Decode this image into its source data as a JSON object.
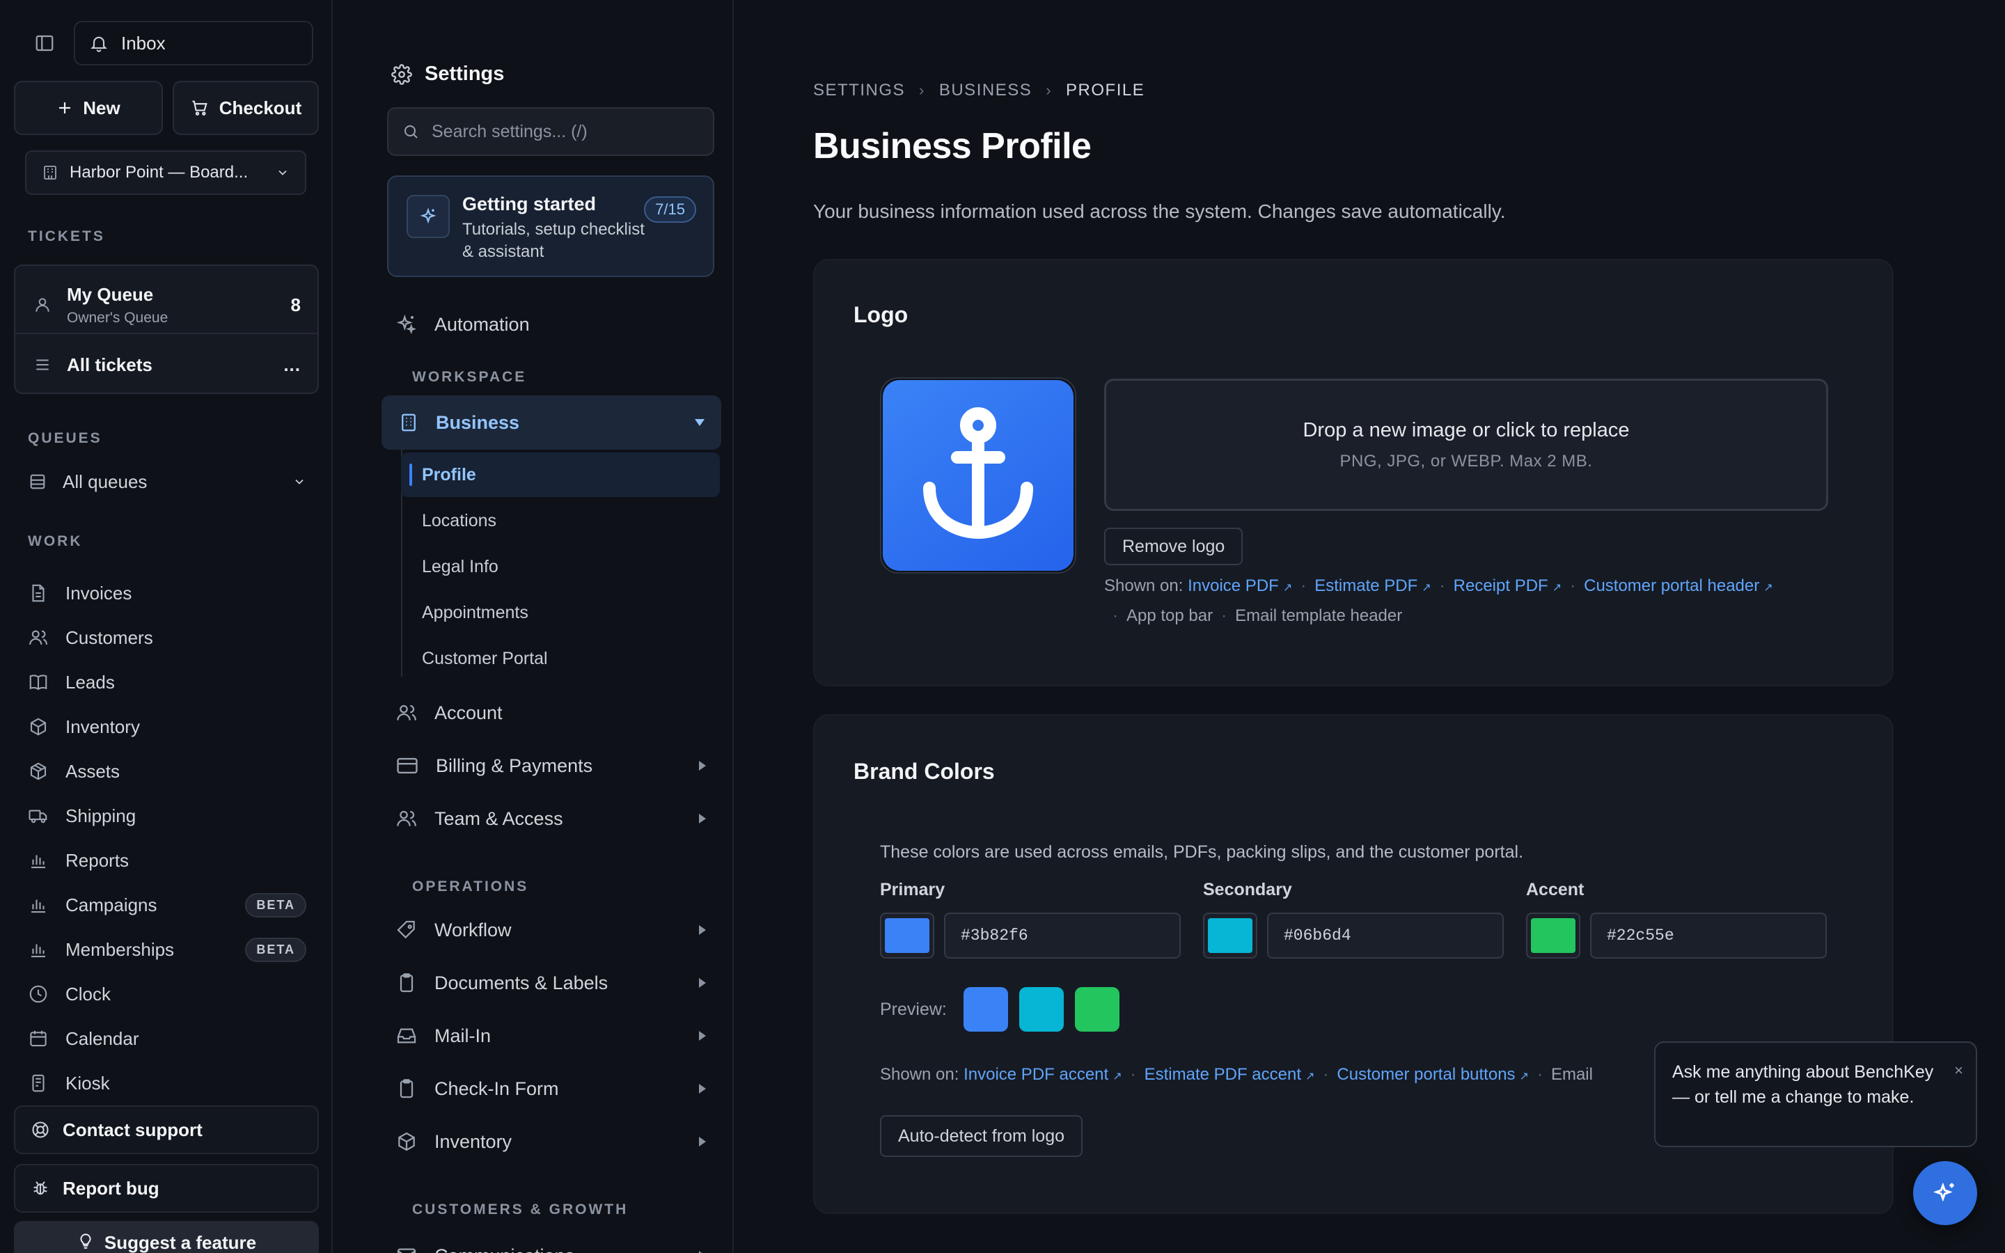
{
  "sidebar": {
    "inbox_label": "Inbox",
    "new_label": "New",
    "checkout_label": "Checkout",
    "org_name": "Harbor Point — Board...",
    "tickets_section": "TICKETS",
    "my_queue": {
      "title": "My Queue",
      "subtitle": "Owner's Queue",
      "count": "8"
    },
    "all_tickets": {
      "title": "All tickets",
      "more": "..."
    },
    "queues_section": "QUEUES",
    "all_queues_label": "All queues",
    "work_section": "WORK",
    "work_items": [
      {
        "label": "Invoices",
        "icon": "file-icon"
      },
      {
        "label": "Customers",
        "icon": "users-icon"
      },
      {
        "label": "Leads",
        "icon": "book-icon"
      },
      {
        "label": "Inventory",
        "icon": "box-icon"
      },
      {
        "label": "Assets",
        "icon": "cube-icon"
      },
      {
        "label": "Shipping",
        "icon": "truck-icon"
      },
      {
        "label": "Reports",
        "icon": "bar-chart-icon"
      },
      {
        "label": "Campaigns",
        "icon": "bar-chart-icon",
        "badge": "BETA"
      },
      {
        "label": "Memberships",
        "icon": "bar-chart-icon",
        "badge": "BETA"
      },
      {
        "label": "Clock",
        "icon": "clock-icon"
      },
      {
        "label": "Calendar",
        "icon": "calendar-icon"
      },
      {
        "label": "Kiosk",
        "icon": "tablet-icon"
      }
    ],
    "contact_support_label": "Contact support",
    "report_bug_label": "Report bug",
    "suggest_feature_label": "Suggest a feature"
  },
  "settings_nav": {
    "title": "Settings",
    "search_placeholder": "Search settings... (/)",
    "getting_started": {
      "title": "Getting started",
      "subtitle": "Tutorials, setup checklist & assistant",
      "progress": "7/15"
    },
    "automation_label": "Automation",
    "workspace_section": "WORKSPACE",
    "business_label": "Business",
    "business_subitems": [
      "Profile",
      "Locations",
      "Legal Info",
      "Appointments",
      "Customer Portal"
    ],
    "active_subitem": "Profile",
    "account_label": "Account",
    "billing_label": "Billing & Payments",
    "team_label": "Team & Access",
    "operations_section": "OPERATIONS",
    "operations_items": [
      "Workflow",
      "Documents & Labels",
      "Mail-In",
      "Check-In Form",
      "Inventory"
    ],
    "customers_section": "CUSTOMERS & GROWTH",
    "communications_label": "Communications"
  },
  "main": {
    "breadcrumb": [
      "SETTINGS",
      "BUSINESS",
      "PROFILE"
    ],
    "title": "Business Profile",
    "description": "Your business information used across the system. Changes save automatically.",
    "logo_card": {
      "title": "Logo",
      "dropzone_title": "Drop a new image or click to replace",
      "dropzone_sub": "PNG, JPG, or WEBP. Max 2 MB.",
      "remove_label": "Remove logo",
      "shown_on_label": "Shown on:",
      "links": [
        "Invoice PDF",
        "Estimate PDF",
        "Receipt PDF",
        "Customer portal header"
      ],
      "plain": [
        "App top bar",
        "Email template header"
      ]
    },
    "brand_card": {
      "title": "Brand Colors",
      "description": "These colors are used across emails, PDFs, packing slips, and the customer portal.",
      "fields": [
        {
          "label": "Primary",
          "value": "#3b82f6"
        },
        {
          "label": "Secondary",
          "value": "#06b6d4"
        },
        {
          "label": "Accent",
          "value": "#22c55e"
        }
      ],
      "preview_label": "Preview:",
      "shown_on_label": "Shown on:",
      "links": [
        "Invoice PDF accent",
        "Estimate PDF accent",
        "Customer portal buttons"
      ],
      "plain_truncated": "Email",
      "auto_detect_label": "Auto-detect from logo"
    }
  },
  "assistant": {
    "message": "Ask me anything about BenchKey — or tell me a change to make.",
    "close": "×"
  },
  "colors": {
    "accent_blue": "#3b82f6",
    "link_blue": "#60a5fa",
    "background": "#0e1117",
    "card": "#161a23"
  }
}
